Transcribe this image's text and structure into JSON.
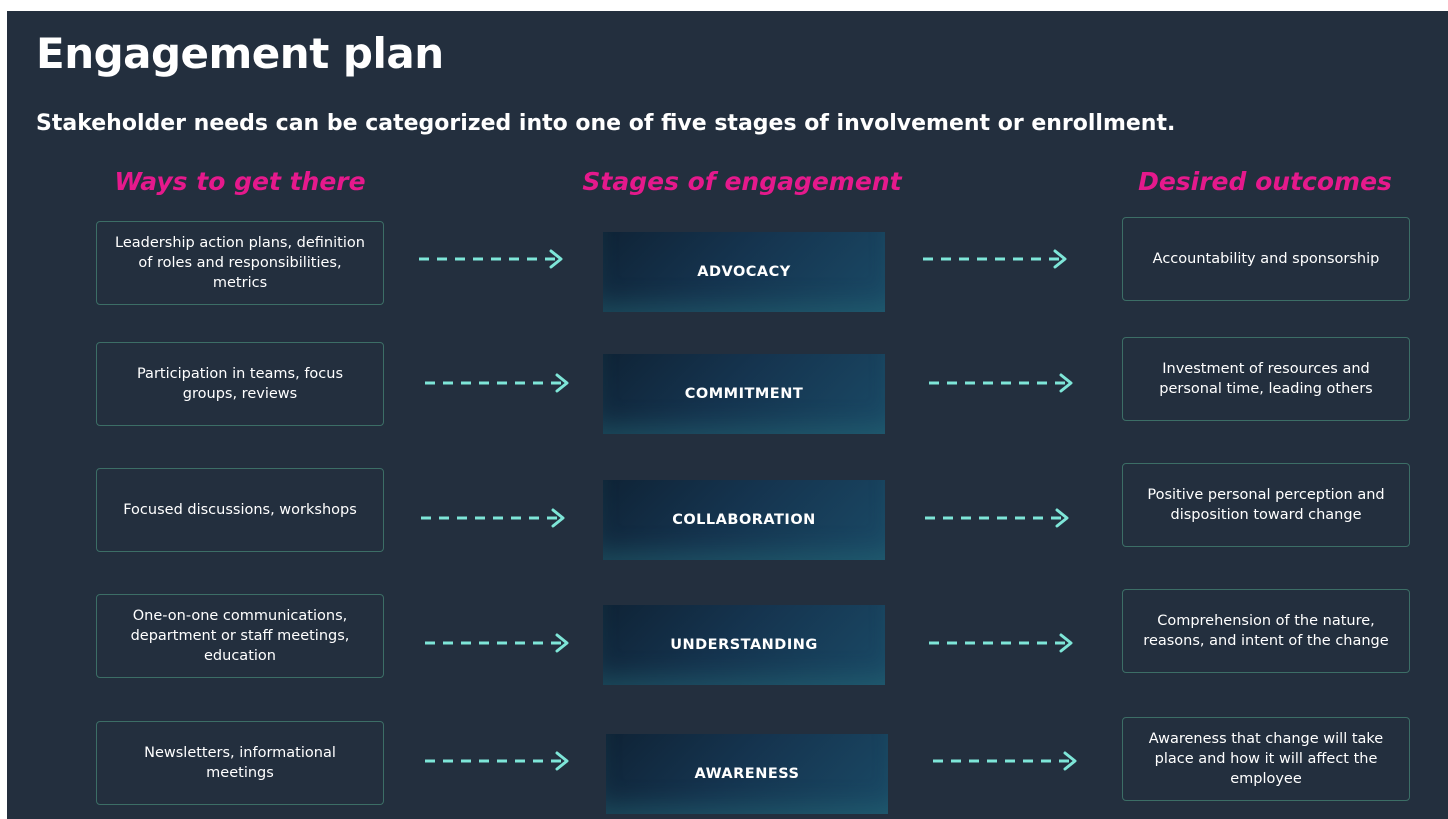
{
  "slide": {
    "title": "Engagement plan",
    "subtitle": "Stakeholder needs can be categorized into one of five stages of involvement or enrollment."
  },
  "headings": {
    "ways": "Ways to get there",
    "stages": "Stages of engagement",
    "outcomes": "Desired outcomes"
  },
  "colors": {
    "background": "#232f3e",
    "heading_accent": "#e5198c",
    "arrow": "#7ee6d8",
    "box_border": "#3c6e66"
  },
  "rows": [
    {
      "way": "Leadership action plans, definition of roles and responsibilities, metrics",
      "stage": "ADVOCACY",
      "outcome": "Accountability and sponsorship"
    },
    {
      "way": "Participation in teams, focus groups, reviews",
      "stage": "COMMITMENT",
      "outcome": "Investment of resources and personal time, leading others"
    },
    {
      "way": "Focused discussions, workshops",
      "stage": "COLLABORATION",
      "outcome": "Positive personal perception and disposition toward change"
    },
    {
      "way": "One-on-one communications, department or staff meetings, education",
      "stage": "UNDERSTANDING",
      "outcome": "Comprehension of the nature, reasons, and intent of the change"
    },
    {
      "way": "Newsletters, informational meetings",
      "stage": "AWARENESS",
      "outcome": "Awareness that change will take place and how it will affect the employee"
    }
  ]
}
